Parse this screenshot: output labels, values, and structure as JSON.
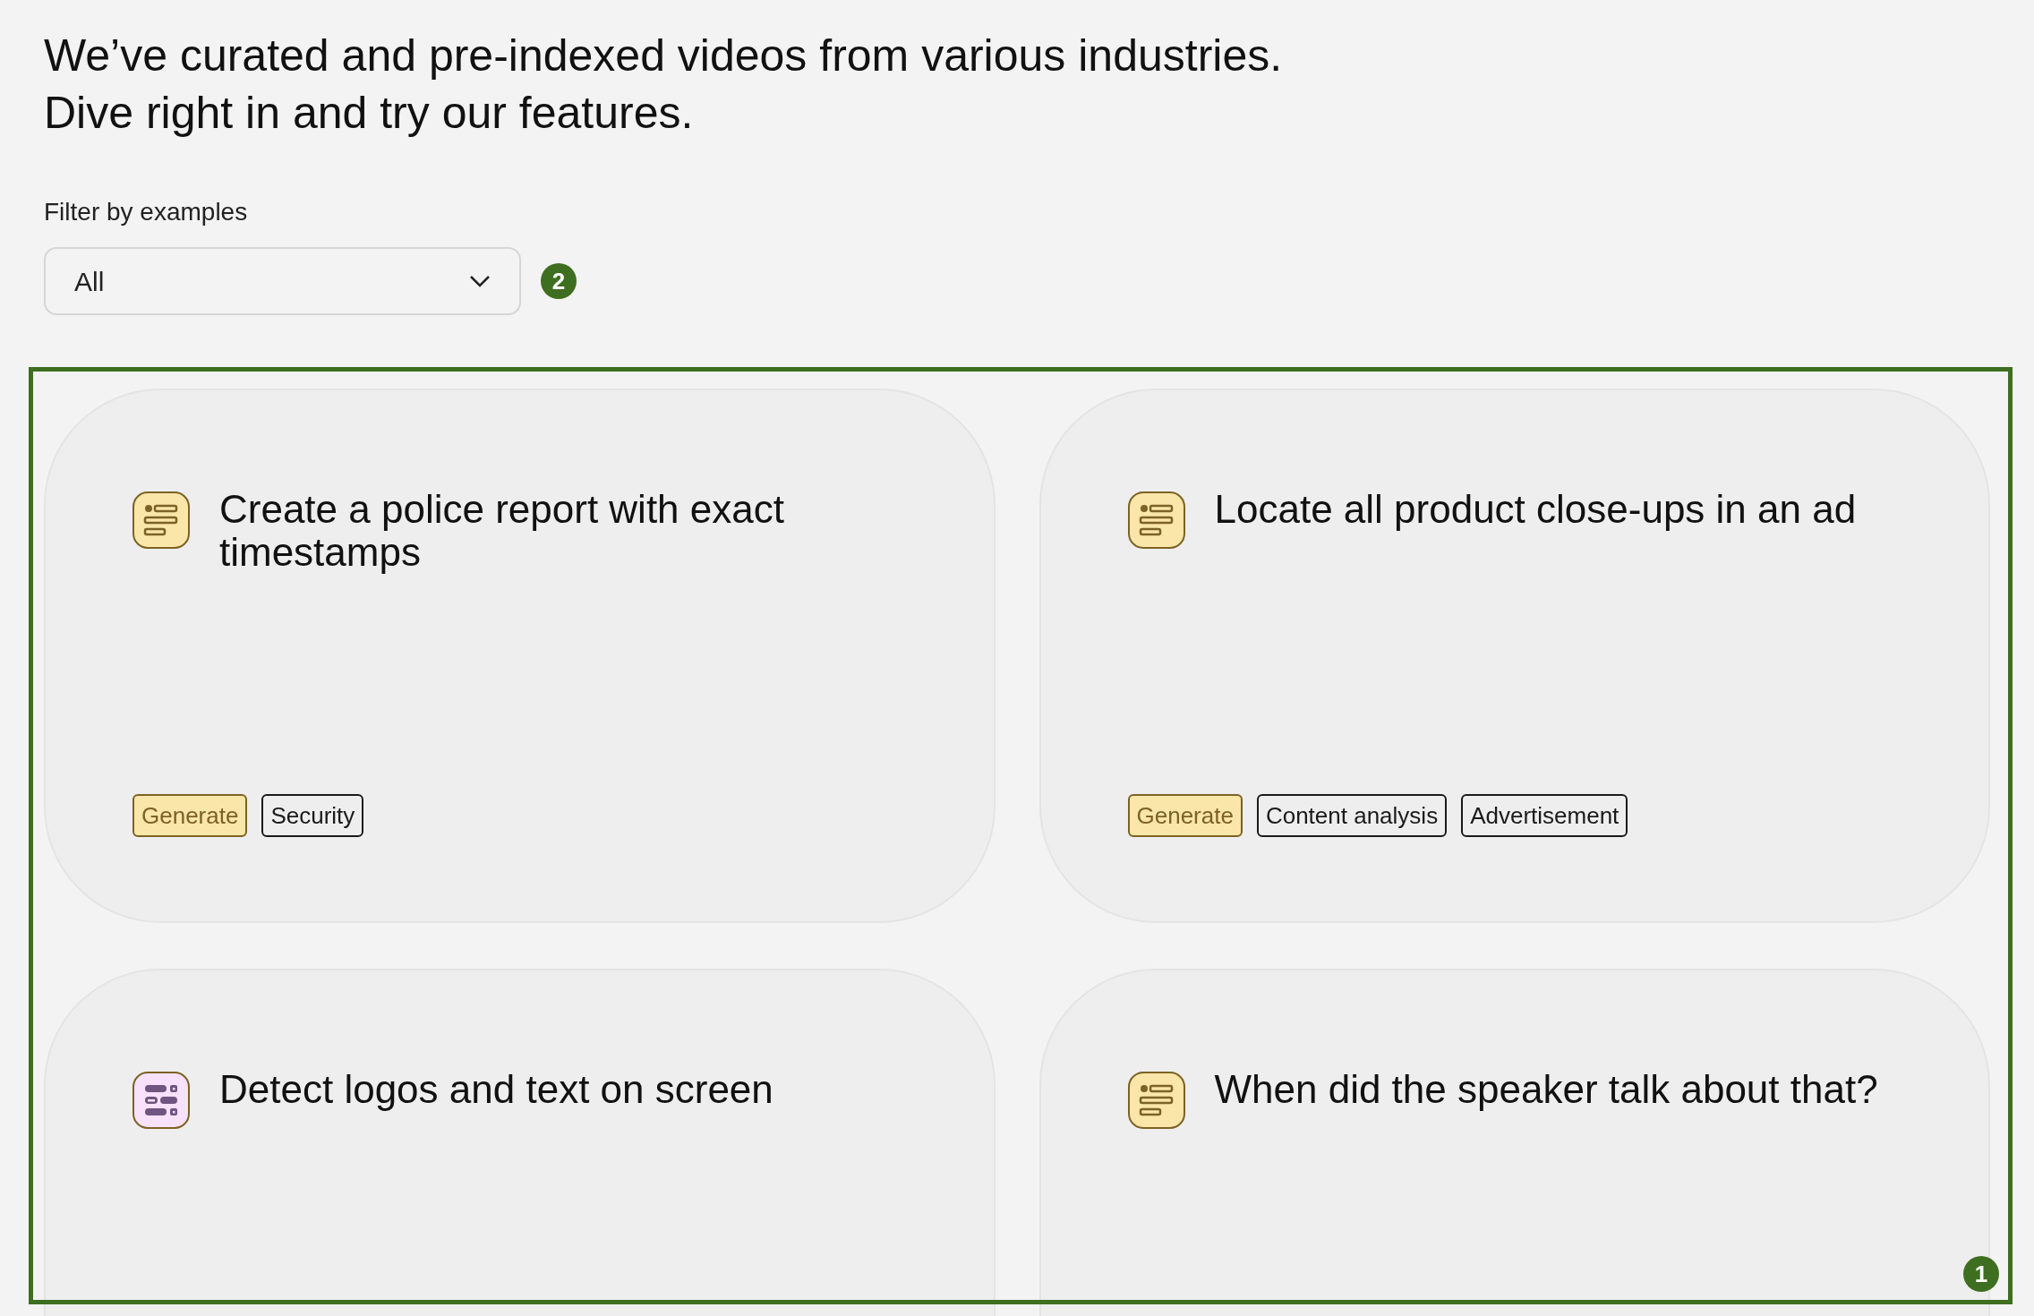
{
  "heading": {
    "lines": [
      "We’ve curated and pre-indexed videos from various industries.",
      "Dive right in and try our features."
    ]
  },
  "filter": {
    "label": "Filter by examples",
    "value": "All",
    "badge": "2"
  },
  "cards_region": {
    "badge": "1"
  },
  "cards": [
    {
      "title": "Create a police report with exact timestamps",
      "kind": "generate",
      "tags": [
        {
          "label": "Generate",
          "kind": "action"
        },
        {
          "label": "Security",
          "kind": "category"
        }
      ]
    },
    {
      "title": "Locate all product close-ups in an ad",
      "kind": "generate",
      "tags": [
        {
          "label": "Generate",
          "kind": "action"
        },
        {
          "label": "Content analysis",
          "kind": "category"
        },
        {
          "label": "Advertisement",
          "kind": "category"
        }
      ]
    },
    {
      "title": "Detect logos and text on screen",
      "kind": "detect"
    },
    {
      "title": "When did the speaker talk about that?",
      "kind": "generate"
    }
  ]
}
